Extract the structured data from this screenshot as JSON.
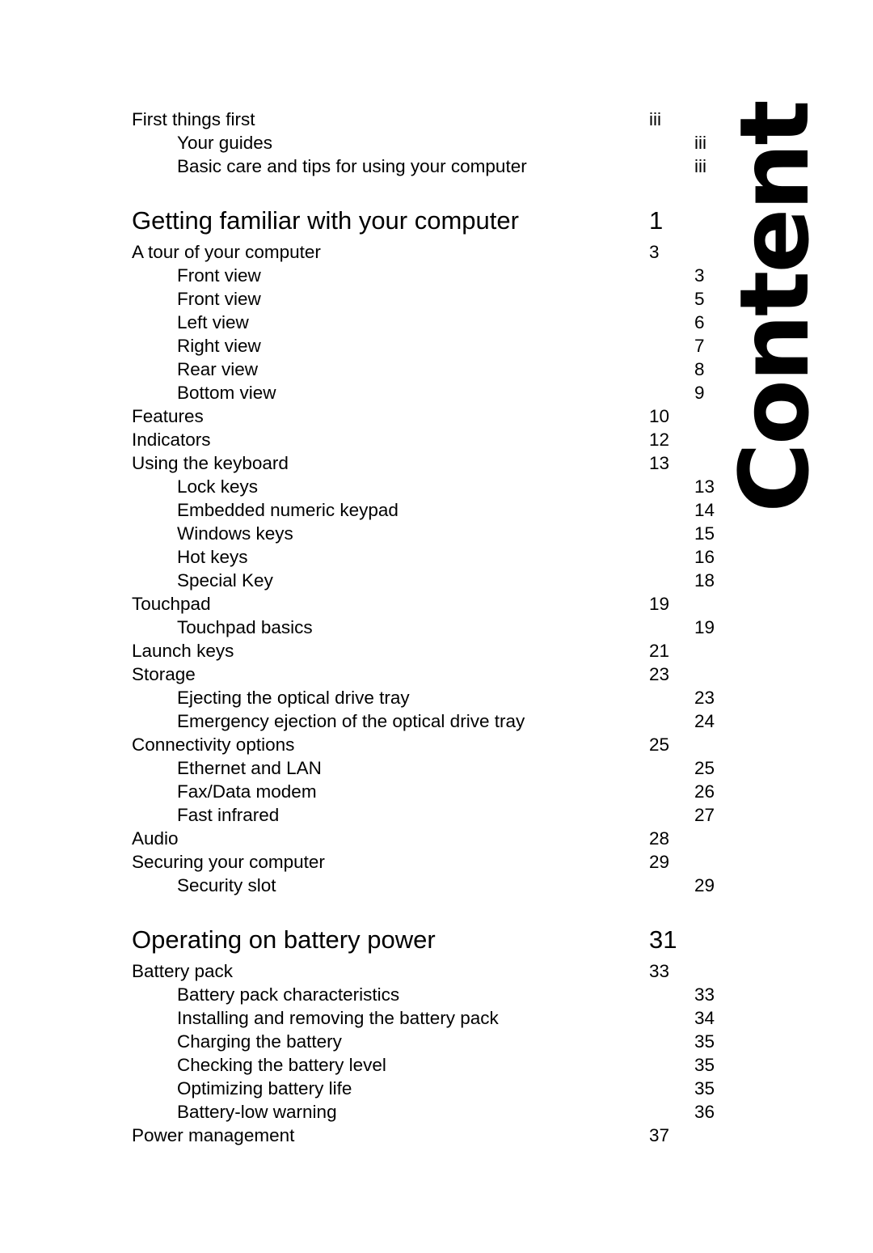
{
  "document": {
    "side_title": "Content"
  },
  "toc": {
    "entries": [
      {
        "level": 1,
        "label": "First things first",
        "page": "iii"
      },
      {
        "level": 2,
        "label": "Your guides",
        "page": "iii"
      },
      {
        "level": 2,
        "label": "Basic care and tips for using your computer",
        "page": "iii"
      },
      {
        "level": 0,
        "label": "Getting familiar with your computer",
        "page": "1"
      },
      {
        "level": 1,
        "label": "A tour of your computer",
        "page": "3"
      },
      {
        "level": 2,
        "label": "Front view",
        "page": "3"
      },
      {
        "level": 2,
        "label": "Front view",
        "page": "5"
      },
      {
        "level": 2,
        "label": "Left view",
        "page": "6"
      },
      {
        "level": 2,
        "label": "Right view",
        "page": "7"
      },
      {
        "level": 2,
        "label": "Rear view",
        "page": "8"
      },
      {
        "level": 2,
        "label": "Bottom view",
        "page": "9"
      },
      {
        "level": 1,
        "label": "Features",
        "page": "10"
      },
      {
        "level": 1,
        "label": "Indicators",
        "page": "12"
      },
      {
        "level": 1,
        "label": "Using the keyboard",
        "page": "13"
      },
      {
        "level": 2,
        "label": "Lock keys",
        "page": "13"
      },
      {
        "level": 2,
        "label": "Embedded numeric keypad",
        "page": "14"
      },
      {
        "level": 2,
        "label": "Windows keys",
        "page": "15"
      },
      {
        "level": 2,
        "label": "Hot keys",
        "page": "16"
      },
      {
        "level": 2,
        "label": "Special Key",
        "page": "18"
      },
      {
        "level": 1,
        "label": "Touchpad",
        "page": "19"
      },
      {
        "level": 2,
        "label": "Touchpad basics",
        "page": "19"
      },
      {
        "level": 1,
        "label": "Launch keys",
        "page": "21"
      },
      {
        "level": 1,
        "label": "Storage",
        "page": "23"
      },
      {
        "level": 2,
        "label": "Ejecting the optical drive tray",
        "page": "23"
      },
      {
        "level": 2,
        "label": "Emergency ejection of the optical drive tray",
        "page": "24"
      },
      {
        "level": 1,
        "label": "Connectivity options",
        "page": "25"
      },
      {
        "level": 2,
        "label": "Ethernet and LAN",
        "page": "25"
      },
      {
        "level": 2,
        "label": "Fax/Data modem",
        "page": "26"
      },
      {
        "level": 2,
        "label": "Fast infrared",
        "page": "27"
      },
      {
        "level": 1,
        "label": "Audio",
        "page": "28"
      },
      {
        "level": 1,
        "label": "Securing your computer",
        "page": "29"
      },
      {
        "level": 2,
        "label": "Security slot",
        "page": "29"
      },
      {
        "level": 0,
        "label": "Operating on battery power",
        "page": "31"
      },
      {
        "level": 1,
        "label": "Battery pack",
        "page": "33"
      },
      {
        "level": 2,
        "label": "Battery pack characteristics",
        "page": "33"
      },
      {
        "level": 2,
        "label": "Installing and removing the battery pack",
        "page": "34"
      },
      {
        "level": 2,
        "label": "Charging the battery",
        "page": "35"
      },
      {
        "level": 2,
        "label": "Checking the battery level",
        "page": "35"
      },
      {
        "level": 2,
        "label": "Optimizing battery life",
        "page": "35"
      },
      {
        "level": 2,
        "label": "Battery-low warning",
        "page": "36"
      },
      {
        "level": 1,
        "label": "Power management",
        "page": "37"
      }
    ]
  }
}
